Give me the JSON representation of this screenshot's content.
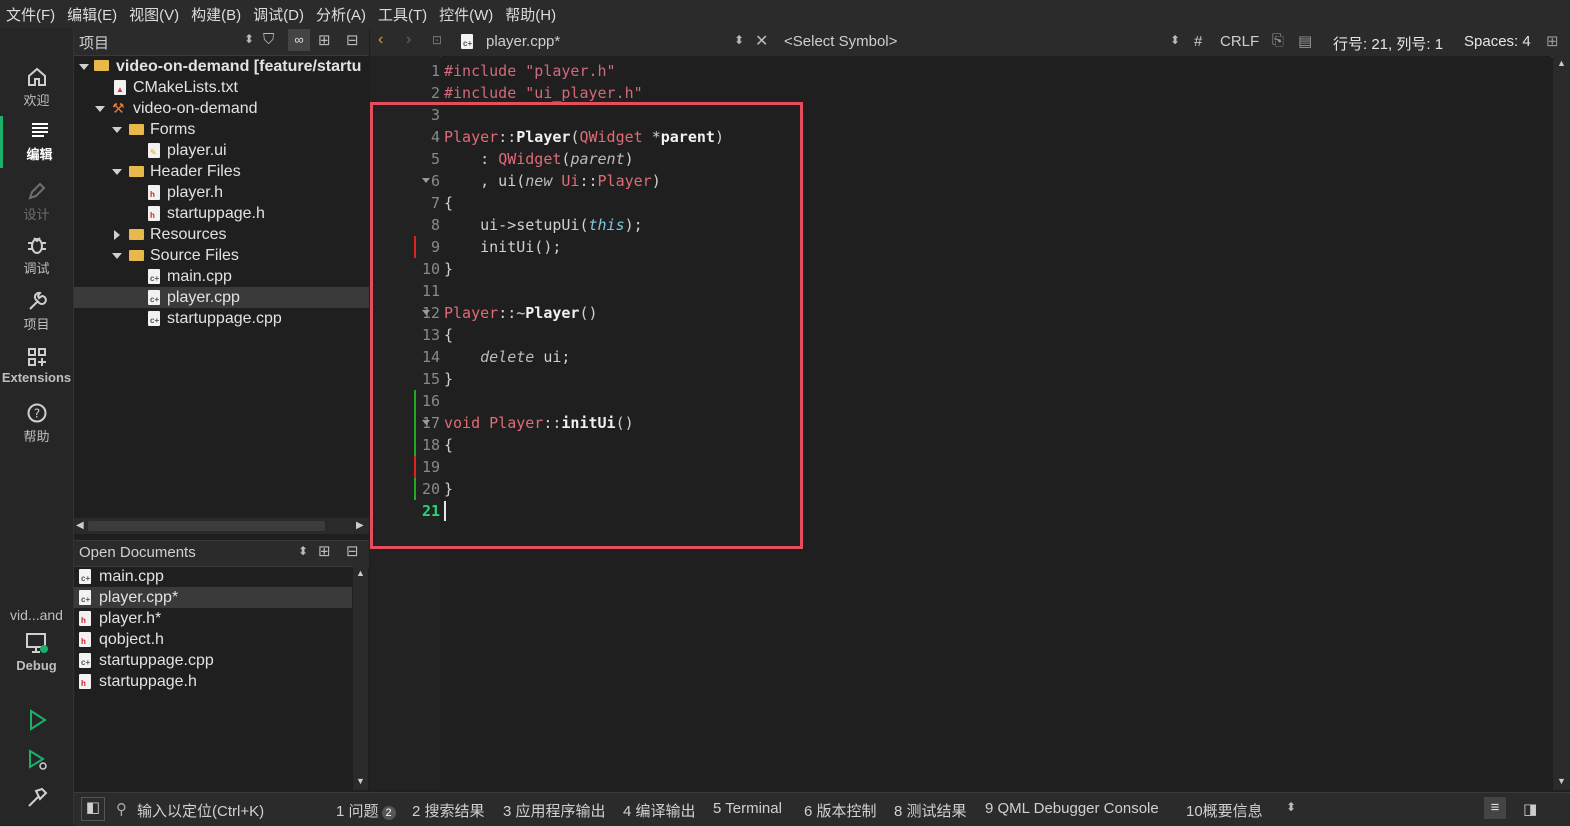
{
  "menubar": [
    "文件(F)",
    "编辑(E)",
    "视图(V)",
    "构建(B)",
    "调试(D)",
    "分析(A)",
    "工具(T)",
    "控件(W)",
    "帮助(H)"
  ],
  "modes": {
    "welcome": "欢迎",
    "edit": "编辑",
    "design": "设计",
    "debug": "调试",
    "projects": "项目",
    "extensions": "Extensions",
    "help": "帮助"
  },
  "kit": {
    "project": "vid...and",
    "config": "Debug"
  },
  "project_panel": {
    "title": "项目"
  },
  "tree": {
    "root": "video-on-demand [feature/startu",
    "cmake": "CMakeLists.txt",
    "target": "video-on-demand",
    "forms": "Forms",
    "player_ui": "player.ui",
    "headers": "Header Files",
    "player_h": "player.h",
    "startuppage_h": "startuppage.h",
    "resources": "Resources",
    "sources": "Source Files",
    "main_cpp": "main.cpp",
    "player_cpp": "player.cpp",
    "startuppage_cpp": "startuppage.cpp"
  },
  "open_documents": {
    "title": "Open Documents",
    "items": [
      "main.cpp",
      "player.cpp*",
      "player.h*",
      "qobject.h",
      "startuppage.cpp",
      "startuppage.h"
    ]
  },
  "editor_toolbar": {
    "file": "player.cpp*",
    "symbol": "<Select Symbol>",
    "hash": "#",
    "line_ending": "CRLF",
    "position": "行号: 21, 列号: 1",
    "indent": "Spaces: 4"
  },
  "line_numbers": [
    "1",
    "2",
    "3",
    "4",
    "5",
    "6",
    "7",
    "8",
    "9",
    "10",
    "11",
    "12",
    "13",
    "14",
    "15",
    "16",
    "17",
    "18",
    "19",
    "20",
    "21"
  ],
  "code": {
    "l1a": "#include ",
    "l1b": "\"player.h\"",
    "l2a": "#include ",
    "l2b": "\"ui_player.h\"",
    "l4a": "Player",
    "l4b": "::",
    "l4c": "Player",
    "l4d": "(",
    "l4e": "QWidget",
    "l4f": " *",
    "l4g": "parent",
    "l4h": ")",
    "l5a": "    : ",
    "l5b": "QWidget",
    "l5c": "(",
    "l5d": "parent",
    "l5e": ")",
    "l6a": "    , ui(",
    "l6b": "new",
    "l6c": " ",
    "l6d": "Ui",
    "l6e": "::",
    "l6f": "Player",
    "l6g": ")",
    "l7": "{",
    "l8a": "    ui->setupUi(",
    "l8b": "this",
    "l8c": ");",
    "l9": "    initUi();",
    "l10": "}",
    "l12a": "Player",
    "l12b": "::~",
    "l12c": "Player",
    "l12d": "()",
    "l13": "{",
    "l14a": "    ",
    "l14b": "delete",
    "l14c": " ui;",
    "l15": "}",
    "l17a": "void",
    "l17b": " ",
    "l17c": "Player",
    "l17d": "::",
    "l17e": "initUi",
    "l17f": "()",
    "l18": "{",
    "l20": "}"
  },
  "statusbar": {
    "locator": "输入以定位(Ctrl+K)",
    "issues": "1 问题",
    "issues_count": "2",
    "search": "2 搜索结果",
    "app_output": "3 应用程序输出",
    "compile": "4 编译输出",
    "terminal": "5 Terminal",
    "vcs": "6 版本控制",
    "tests": "8 测试结果",
    "qml": "9 QML Debugger Console",
    "general": "10概要信息"
  },
  "colors": {
    "accent": "#1cb06b",
    "highlight_box": "#e74c5b"
  }
}
